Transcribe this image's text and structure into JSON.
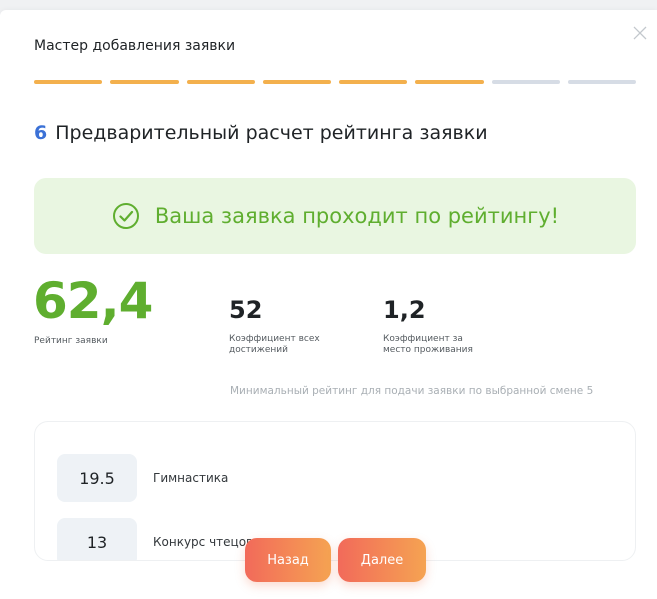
{
  "wizard": {
    "title": "Мастер добавления заявки",
    "steps_total": 8,
    "steps_completed": 6,
    "colors": {
      "active": "#f3b04d",
      "inactive": "#d6dce5"
    }
  },
  "step": {
    "number": "6",
    "title": "Предварительный расчет рейтинга заявки"
  },
  "banner": {
    "icon": "check-circle-icon",
    "text": "Ваша заявка проходит по рейтингу!",
    "color": "#5fae2f"
  },
  "rating": {
    "value": "62,4",
    "label": "Рейтинг заявки"
  },
  "coefficients": [
    {
      "value": "52",
      "label": "Коэффициент всех достижений"
    },
    {
      "value": "1,2",
      "label": "Коэффициент за место проживания"
    }
  ],
  "min_rating_text": "Минимальный рейтинг для подачи заявки по выбранной смене 5",
  "achievements": [
    {
      "score": "19.5",
      "name": "Гимнастика"
    },
    {
      "score": "13",
      "name": "Конкурс чтецов"
    }
  ],
  "buttons": {
    "back": "Назад",
    "next": "Далее"
  },
  "close_icon": "close-icon"
}
